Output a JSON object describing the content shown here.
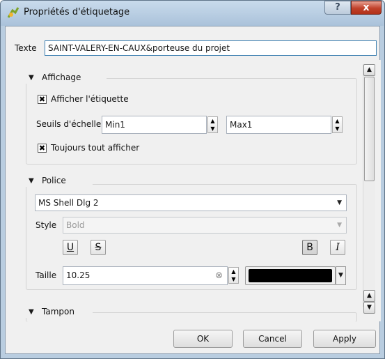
{
  "window": {
    "title": "Propriétés d'étiquetage",
    "help_glyph": "?",
    "close_glyph": "x"
  },
  "text_row": {
    "label": "Texte",
    "value": "SAINT-VALERY-EN-CAUX&porteuse du projet"
  },
  "affichage": {
    "title": "Affichage",
    "show_label": {
      "label": "Afficher l'étiquette",
      "checked": true
    },
    "scale": {
      "label": "Seuils d'échelle",
      "min_value": "Min1",
      "max_value": "Max1"
    },
    "always_show": {
      "label": "Toujours tout afficher",
      "checked": true
    }
  },
  "police": {
    "title": "Police",
    "font_value": "MS Shell Dlg 2",
    "style_label": "Style",
    "style_value": "Bold",
    "underline": "U",
    "strike": "S",
    "bold": "B",
    "italic": "I",
    "size_label": "Taille",
    "size_value": "10.25",
    "color": "#000000"
  },
  "tampon": {
    "title": "Tampon"
  },
  "buttons": {
    "ok": "OK",
    "cancel": "Cancel",
    "apply": "Apply"
  },
  "icons": {
    "expand": "▼",
    "up": "▲",
    "down": "▼",
    "check": "✖",
    "clear": "⊗"
  },
  "colors": {
    "titlebar": "#b9cde0",
    "close": "#c0412a",
    "focus": "#3c7fb1"
  }
}
